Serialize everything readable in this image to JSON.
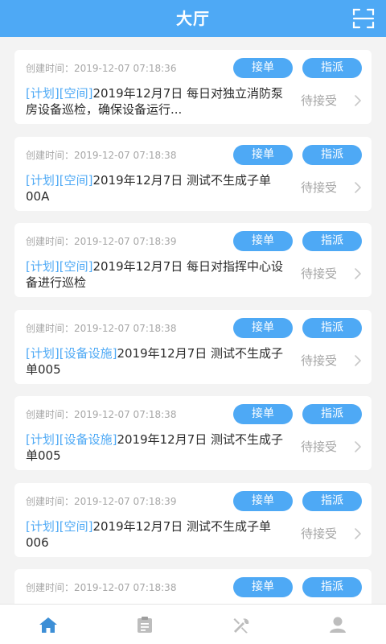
{
  "header": {
    "title": "大厅",
    "scan_icon": "scan-icon"
  },
  "colors": {
    "primary": "#4ea9f5",
    "background": "#f3f3f3",
    "muted": "#a6a6a6",
    "active_tab": "#3d8fd6",
    "inactive_tab": "#bdbdbd"
  },
  "cards": [
    {
      "time": "创建时间：2019-12-07 07:18:36",
      "accept_label": "接单",
      "assign_label": "指派",
      "tags": [
        "计划",
        "空间"
      ],
      "tag_open": "[",
      "tag_close": "]",
      "text": "2019年12月7日 每日对独立消防泵房设备巡检，确保设备运行...",
      "status": "待接受"
    },
    {
      "time": "创建时间：2019-12-07 07:18:38",
      "accept_label": "接单",
      "assign_label": "指派",
      "tags": [
        "计划",
        "空间"
      ],
      "tag_open": "[",
      "tag_close": "]",
      "text": "2019年12月7日 测试不生成子单00A",
      "status": "待接受"
    },
    {
      "time": "创建时间：2019-12-07 07:18:39",
      "accept_label": "接单",
      "assign_label": "指派",
      "tags": [
        "计划",
        "空间"
      ],
      "tag_open": "[",
      "tag_close": "]",
      "text": "2019年12月7日 每日对指挥中心设备进行巡检",
      "status": "待接受"
    },
    {
      "time": "创建时间：2019-12-07 07:18:38",
      "accept_label": "接单",
      "assign_label": "指派",
      "tags": [
        "计划",
        "设备设施"
      ],
      "tag_open": "[",
      "tag_close": "]",
      "text": "2019年12月7日 测试不生成子单005",
      "status": "待接受"
    },
    {
      "time": "创建时间：2019-12-07 07:18:38",
      "accept_label": "接单",
      "assign_label": "指派",
      "tags": [
        "计划",
        "设备设施"
      ],
      "tag_open": "[",
      "tag_close": "]",
      "text": "2019年12月7日 测试不生成子单005",
      "status": "待接受"
    },
    {
      "time": "创建时间：2019-12-07 07:18:39",
      "accept_label": "接单",
      "assign_label": "指派",
      "tags": [
        "计划",
        "空间"
      ],
      "tag_open": "[",
      "tag_close": "]",
      "text": "2019年12月7日 测试不生成子单006",
      "status": "待接受"
    },
    {
      "time": "创建时间：2019-12-07 07:18:38",
      "accept_label": "接单",
      "assign_label": "指派",
      "tags": [],
      "tag_open": "",
      "tag_close": "",
      "text": "",
      "status": ""
    }
  ],
  "tabbar": {
    "items": [
      {
        "icon": "home-icon",
        "active": true
      },
      {
        "icon": "clipboard-icon",
        "active": false
      },
      {
        "icon": "tools-icon",
        "active": false
      },
      {
        "icon": "user-icon",
        "active": false
      }
    ]
  }
}
